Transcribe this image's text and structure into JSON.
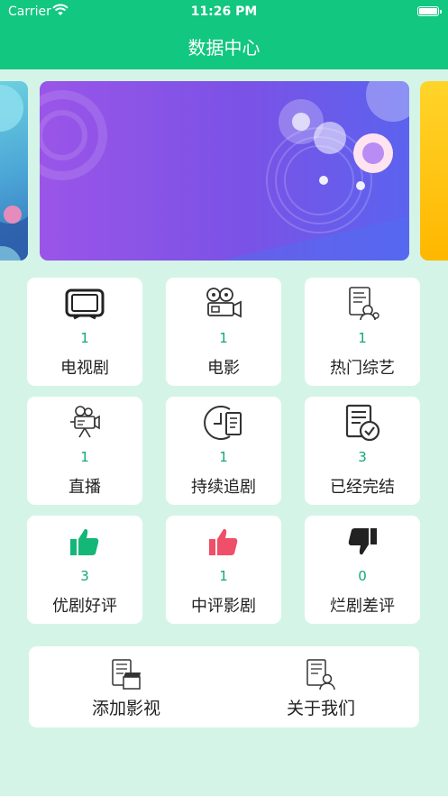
{
  "status_bar": {
    "carrier": "Carrier",
    "time": "11:26 PM"
  },
  "header": {
    "title": "数据中心"
  },
  "colors": {
    "header": "#12c77f",
    "background": "#d5f4e8",
    "count": "#12a877",
    "thumb_good": "#14b778",
    "thumb_mid": "#ef4f68",
    "thumb_bad": "#222222"
  },
  "grid": [
    {
      "icon": "tv-icon",
      "count": "1",
      "label": "电视剧"
    },
    {
      "icon": "film-projector-icon",
      "count": "1",
      "label": "电影"
    },
    {
      "icon": "variety-doc-icon",
      "count": "1",
      "label": "热门综艺"
    },
    {
      "icon": "video-camera-icon",
      "count": "1",
      "label": "直播"
    },
    {
      "icon": "ongoing-clock-icon",
      "count": "1",
      "label": "持续追剧"
    },
    {
      "icon": "completed-doc-icon",
      "count": "3",
      "label": "已经完结"
    },
    {
      "icon": "thumbs-up-green-icon",
      "count": "3",
      "label": "优剧好评"
    },
    {
      "icon": "thumbs-up-red-icon",
      "count": "1",
      "label": "中评影剧"
    },
    {
      "icon": "thumbs-down-icon",
      "count": "0",
      "label": "烂剧差评"
    }
  ],
  "bottom": [
    {
      "icon": "add-video-icon",
      "label": "添加影视"
    },
    {
      "icon": "about-us-icon",
      "label": "关于我们"
    }
  ]
}
